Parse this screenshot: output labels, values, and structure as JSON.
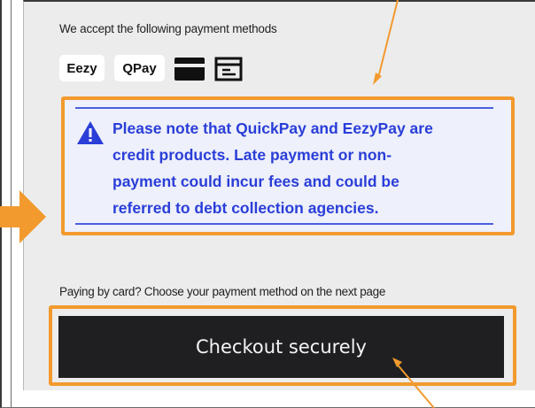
{
  "accepted_methods": {
    "heading": "We accept the following payment methods",
    "badges": [
      "Eezy",
      "QPay"
    ],
    "icons": [
      "credit-card-icon",
      "bank-transfer-icon"
    ]
  },
  "notice": {
    "text": "Please note that QuickPay and EezyPay are credit products. Late payment or non-payment could incur fees and could be referred to debt collection agencies.",
    "lines": [
      "Please note that QuickPay and EezyPay are",
      "credit products. Late payment or non-",
      "payment could incur fees and could be",
      "referred to debt collection agencies."
    ],
    "icon": "warning-triangle-icon"
  },
  "card_hint": "Paying by card? Choose your payment method on the next page",
  "checkout": {
    "label": "Checkout securely"
  },
  "annotations": {
    "highlight_color": "#f29a2e",
    "notice_text_color": "#2a3ed8",
    "button_color": "#1f1f22"
  }
}
